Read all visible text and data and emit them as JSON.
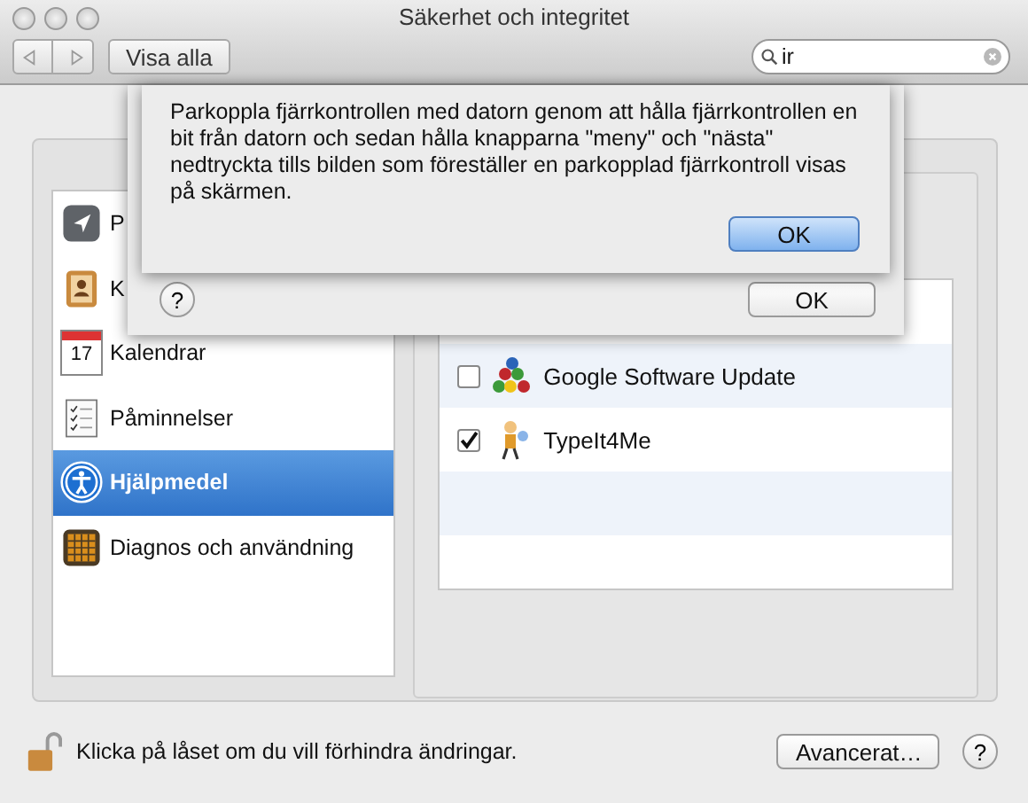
{
  "window": {
    "title": "Säkerhet och integritet"
  },
  "toolbar": {
    "show_all": "Visa alla",
    "search": {
      "value": "ir"
    }
  },
  "sidebar": {
    "items": [
      {
        "label": "P",
        "kind": "location",
        "selected": false
      },
      {
        "label": "K",
        "kind": "contacts",
        "selected": false
      },
      {
        "label": "Kalendrar",
        "kind": "calendar",
        "icon_text": "17",
        "selected": false
      },
      {
        "label": "Påminnelser",
        "kind": "reminders",
        "selected": false
      },
      {
        "label": "Hjälpmedel",
        "kind": "accessibility",
        "selected": true
      },
      {
        "label": "Diagnos och användning",
        "kind": "diagnostics",
        "selected": false
      }
    ]
  },
  "apps": [
    {
      "name": "Google Software Update",
      "kind": "balls",
      "checked": false
    },
    {
      "name": "TypeIt4Me",
      "kind": "figure",
      "checked": true
    }
  ],
  "footer": {
    "lock_text": "Klicka på låset om du vill förhindra ändringar.",
    "advanced": "Avancerat…",
    "help": "?"
  },
  "outer_sheet": {
    "help": "?",
    "ok": "OK"
  },
  "inner_sheet": {
    "message": "Parkoppla fjärrkontrollen med datorn genom att hålla fjärrkontrollen en bit från datorn och sedan hålla knapparna \"meny\" och \"nästa\" nedtryckta tills bilden som föreställer en parkopplad fjärrkontroll visas på skärmen.",
    "ok": "OK",
    "default": true
  }
}
